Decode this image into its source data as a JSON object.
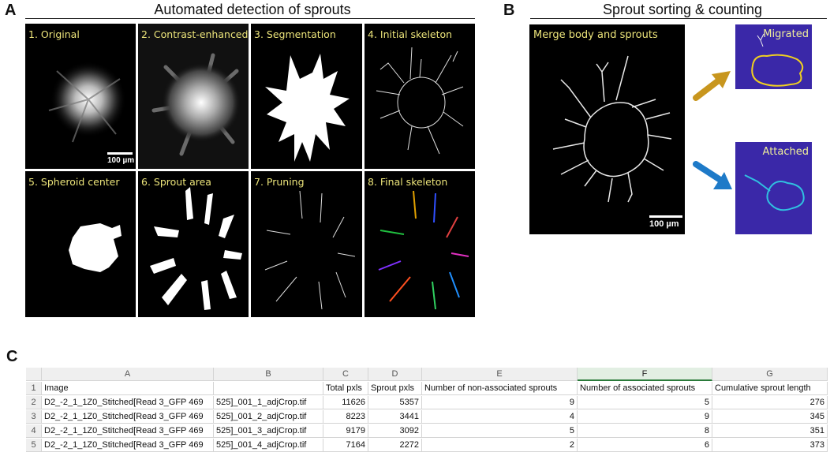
{
  "panel_a": {
    "letter": "A",
    "header": "Automated detection of sprouts",
    "tiles": [
      {
        "label": "1. Original"
      },
      {
        "label": "2. Contrast-enhanced"
      },
      {
        "label": "3. Segmentation"
      },
      {
        "label": "4. Initial skeleton"
      },
      {
        "label": "5. Spheroid center"
      },
      {
        "label": "6. Sprout area"
      },
      {
        "label": "7. Pruning"
      },
      {
        "label": "8. Final skeleton"
      }
    ],
    "scalebar": "100 µm"
  },
  "panel_b": {
    "letter": "B",
    "header": "Sprout sorting & counting",
    "main_label": "Merge body and sprouts",
    "scalebar": "100 µm",
    "migrated_label": "Migrated",
    "attached_label": "Attached",
    "colors": {
      "migrated_arrow": "#c8961e",
      "attached_arrow": "#1e7ac8",
      "thumb_bg": "#3a28a8",
      "migrated_line": "#f0d020",
      "attached_line": "#30c0e0"
    }
  },
  "panel_c": {
    "letter": "C",
    "columns": [
      "",
      "A",
      "B",
      "C",
      "D",
      "E",
      "F",
      "G"
    ],
    "rows": [
      [
        "1",
        "Image",
        "",
        "Total pxls",
        "Sprout pxls",
        "Number of non-associated sprouts",
        "Number of associated sprouts",
        "Cumulative sprout length"
      ],
      [
        "2",
        "D2_-2_1_1Z0_Stitched[Read 3_GFP 469",
        "525]_001_1_adjCrop.tif",
        "11626",
        "5357",
        "9",
        "5",
        "276"
      ],
      [
        "3",
        "D2_-2_1_1Z0_Stitched[Read 3_GFP 469",
        "525]_001_2_adjCrop.tif",
        "8223",
        "3441",
        "4",
        "9",
        "345"
      ],
      [
        "4",
        "D2_-2_1_1Z0_Stitched[Read 3_GFP 469",
        "525]_001_3_adjCrop.tif",
        "9179",
        "3092",
        "5",
        "8",
        "351"
      ],
      [
        "5",
        "D2_-2_1_1Z0_Stitched[Read 3_GFP 469",
        "525]_001_4_adjCrop.tif",
        "7164",
        "2272",
        "2",
        "6",
        "373"
      ]
    ]
  }
}
